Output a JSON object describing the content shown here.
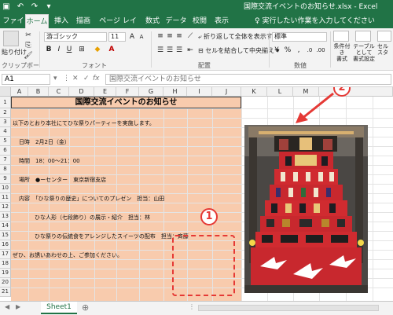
{
  "titlebar": {
    "title": "国際交流イベントのお知らせ.xlsx  -  Excel",
    "qat_icons": [
      "save-icon",
      "undo-icon",
      "redo-icon",
      "dropdown-icon"
    ]
  },
  "ribbon_tabs": [
    "ファイル",
    "ホーム",
    "挿入",
    "描画",
    "ページ レイアウト",
    "数式",
    "データ",
    "校閲",
    "表示"
  ],
  "tell_me": "♀ 実行したい作業を入力してください",
  "ribbon": {
    "paste_label": "貼り付け",
    "clipboard_label": "クリップボード",
    "font_name": "游ゴシック",
    "font_size": "11",
    "font_group_label": "フォント",
    "wrap_text": "折り返して全体を表示する",
    "merge_center": "セルを結合して中央揃え",
    "align_group_label": "配置",
    "number_format": "標準",
    "number_group_label": "数値",
    "cond_format_line1": "条件付き",
    "cond_format_line2": "書式",
    "table_format_line1": "テーブルとして",
    "table_format_line2": "書式設定",
    "cell_style_line1": "セル",
    "cell_style_line2": "スタ"
  },
  "formula_bar": {
    "name_box": "A1",
    "content": "国際交流イベントのお知らせ"
  },
  "columns": [
    "A",
    "B",
    "C",
    "D",
    "E",
    "F",
    "G",
    "H",
    "I",
    "J",
    "K",
    "L",
    "M"
  ],
  "rows": [
    "1",
    "2",
    "3",
    "4",
    "5",
    "6",
    "7",
    "8",
    "9",
    "10",
    "11",
    "12",
    "13",
    "14",
    "15",
    "16",
    "17",
    "18",
    "19",
    "20",
    "21"
  ],
  "cells": {
    "title": "国際交流イベントのお知らせ",
    "r3": "以下のとおり本社にてひな祭りパーティーを実施します。",
    "r5": "日時　2月2日（金）",
    "r7": "時間　18：00～21：00",
    "r9": "場所　●ーセンター　東京新宿支店",
    "r11": "内容　「ひな祭りの歴史」についてのプレゼン　担当：山田",
    "r13": "ひな人形（七段飾り）の展示・紹介　担当：林",
    "r15": "ひな祭りの伝統食をアレンジしたスイーツの配布　担当：斉藤",
    "r17": "ぜひ、お誘いあわせの上、ご参加ください。"
  },
  "annotations": {
    "marker1": "1",
    "marker2": "2",
    "marker_color": "#e53935"
  },
  "sheet_tabs": [
    "Sheet1"
  ],
  "colors": {
    "excel_green": "#217346",
    "peach_fill": "#f8cbad"
  }
}
